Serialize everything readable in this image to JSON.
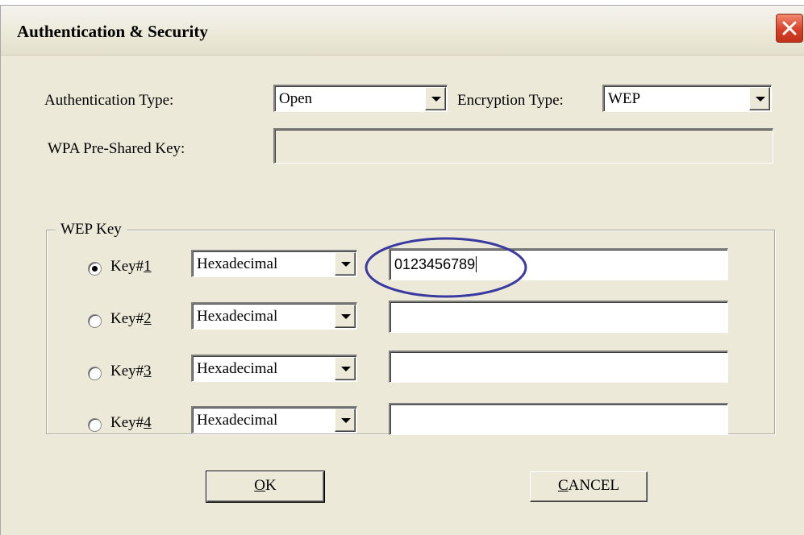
{
  "window": {
    "title": "Authentication & Security"
  },
  "auth": {
    "auth_type_label": "Authentication Type:",
    "auth_type_value": "Open",
    "enc_type_label": "Encryption Type:",
    "enc_type_value": "WEP",
    "wpa_label": "WPA Pre-Shared Key:",
    "wpa_value": ""
  },
  "wep": {
    "group_label": "WEP Key",
    "keys": [
      {
        "label_prefix": "Key#",
        "label_num": "1",
        "format": "Hexadecimal",
        "value": "0123456789",
        "selected": true
      },
      {
        "label_prefix": "Key#",
        "label_num": "2",
        "format": "Hexadecimal",
        "value": "",
        "selected": false
      },
      {
        "label_prefix": "Key#",
        "label_num": "3",
        "format": "Hexadecimal",
        "value": "",
        "selected": false
      },
      {
        "label_prefix": "Key#",
        "label_num": "4",
        "format": "Hexadecimal",
        "value": "",
        "selected": false
      }
    ]
  },
  "buttons": {
    "ok_mnemonic": "O",
    "ok_rest": "K",
    "cancel_mnemonic": "C",
    "cancel_rest": "ANCEL"
  },
  "icons": {
    "close": "close-icon",
    "dropdown": "chevron-down-icon"
  },
  "colors": {
    "highlight_ellipse": "#3a3aa0",
    "close_button": "#d8402a",
    "dialog_background": "#ece9d8"
  }
}
